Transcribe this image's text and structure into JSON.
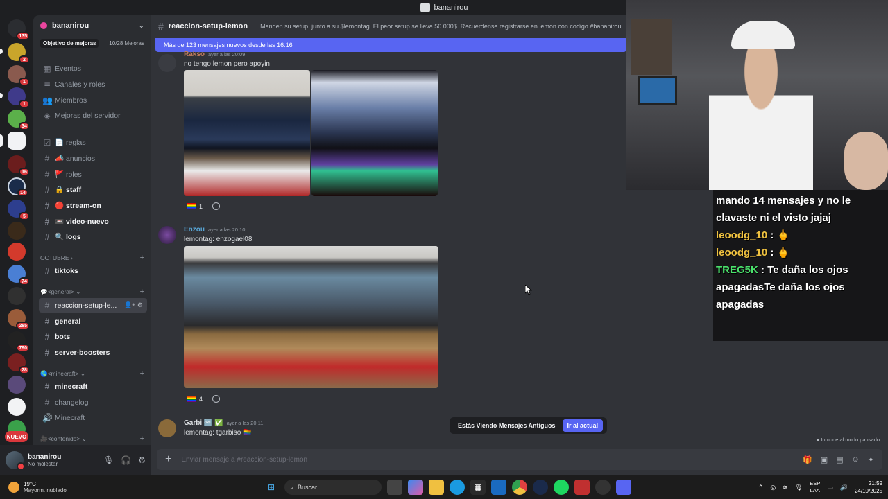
{
  "window": {
    "title": "bananirou"
  },
  "rail": {
    "badges": [
      "135",
      "2",
      "1",
      "1",
      "34",
      "16",
      "14",
      "5",
      "74",
      "285",
      "790",
      "28"
    ],
    "new_label": "NUEVO"
  },
  "sidebar": {
    "guild_name": "bananirou",
    "boost_goal": "Objetivo de mejoras",
    "boost_count": "10/28 Mejoras",
    "nav": [
      {
        "label": "Eventos",
        "icon": "calendar-icon"
      },
      {
        "label": "Canales y roles",
        "icon": "list-icon"
      },
      {
        "label": "Miembros",
        "icon": "members-icon"
      },
      {
        "label": "Mejoras del servidor",
        "icon": "boost-icon"
      }
    ],
    "channels_top": [
      {
        "label": "📄 reglas"
      },
      {
        "label": "📣 anuncios"
      },
      {
        "label": "🚩 roles"
      },
      {
        "label": "🔒 staff"
      },
      {
        "label": "🔴 stream-on"
      },
      {
        "label": "📼 video-nuevo"
      },
      {
        "label": "🔍 logs"
      }
    ],
    "cat_octubre": "OCTUBRE",
    "tiktoks": "tiktoks",
    "cat_general": "💬<general>",
    "channels_general": [
      {
        "label": "reaccion-setup-le..."
      },
      {
        "label": "general"
      },
      {
        "label": "bots"
      },
      {
        "label": "server-boosters"
      }
    ],
    "cat_minecraft": "🌎<minecraft>",
    "channels_minecraft": [
      {
        "label": "minecraft"
      },
      {
        "label": "changelog"
      },
      {
        "label": "Minecraft"
      }
    ],
    "cat_contenido": "🎥<contenido>"
  },
  "user_panel": {
    "name": "bananirou",
    "status": "No molestar"
  },
  "channel_header": {
    "name": "reaccion-setup-lemon",
    "topic": "Manden su setup, junto a su $lemontag. El peor setup se lleva 50.000$. Recuerdense registrarse en lemon con codigo #bananirou."
  },
  "new_messages_bar": "Más de 123 mensajes nuevos desde las 16:16",
  "messages": [
    {
      "author": "Rakso",
      "time": "ayer a las 20:09",
      "text": "no tengo lemon pero apoyin",
      "reaction_count": "1",
      "color": "#c27c5e"
    },
    {
      "author": "Enzou",
      "time": "ayer a las 20:10",
      "text": "lemontag: enzogael08",
      "reaction_count": "4",
      "color": "#58a6d6"
    },
    {
      "author": "Garbi 🆒 ✅",
      "time": "ayer a las 20:11",
      "text": "lemontag: tgarbiso 🏳️‍🌈",
      "color": "#dbdee1"
    }
  ],
  "old_messages": {
    "label": "Estás Viendo Mensajes Antiguos",
    "jump": "Ir al actual"
  },
  "paused": "Inmune al modo pausado",
  "composer": {
    "placeholder": "Enviar mensaje a #reaccion-setup-lemon"
  },
  "stream_chat": [
    {
      "user": "",
      "text": "mando 14 mensajes y no le clavaste ni el visto jajaj"
    },
    {
      "user": "leoodg_10",
      "text": "🖕"
    },
    {
      "user": "leoodg_10",
      "text": "🖕"
    },
    {
      "user": "TREG5K",
      "text": "Te daña los ojos apagadasTe daña los ojos apagadas"
    }
  ],
  "taskbar": {
    "temp": "19°C",
    "weather": "Mayorm. nublado",
    "search": "Buscar",
    "lang_top": "ESP",
    "lang_bottom": "LAA",
    "time": "21:59",
    "date": "24/10/2025"
  }
}
